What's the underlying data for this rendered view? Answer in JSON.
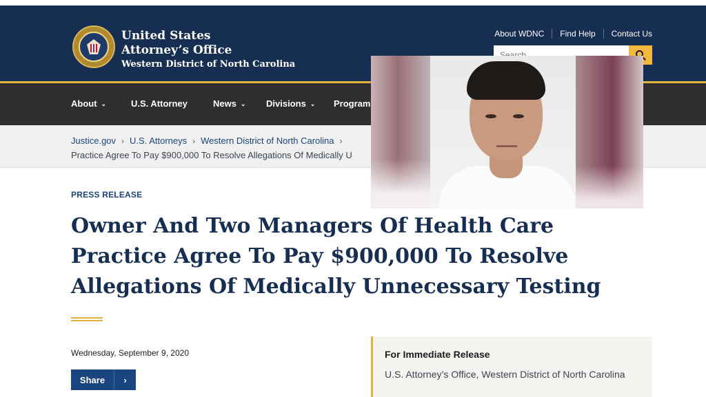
{
  "header": {
    "agency_line1": "United States",
    "agency_line2": "Attorney’s Office",
    "agency_line3": "Western District of North Carolina",
    "utility_links": [
      "About WDNC",
      "Find Help",
      "Contact Us"
    ],
    "search_placeholder": "Search",
    "search_icon": "search-icon",
    "accent_color": "#e2b23a",
    "header_bg": "#162e51"
  },
  "nav": {
    "items": [
      "About",
      "U.S. Attorney",
      "News",
      "Divisions",
      "Program"
    ]
  },
  "breadcrumb": {
    "links": [
      "Justice.gov",
      "U.S. Attorneys",
      "Western District of North Carolina"
    ],
    "current": "Practice Agree To Pay $900,000 To Resolve Allegations Of Medically U"
  },
  "article": {
    "eyebrow": "PRESS RELEASE",
    "headline": "Owner And Two Managers Of Health Care Practice Agree To Pay $900,000 To Resolve Allegations Of Medically Unnecessary Testing",
    "date": "Wednesday, September 9, 2020",
    "share_label": "Share",
    "release_title": "For Immediate Release",
    "release_text": "U.S. Attorney’s Office, Western District of North Carolina"
  }
}
